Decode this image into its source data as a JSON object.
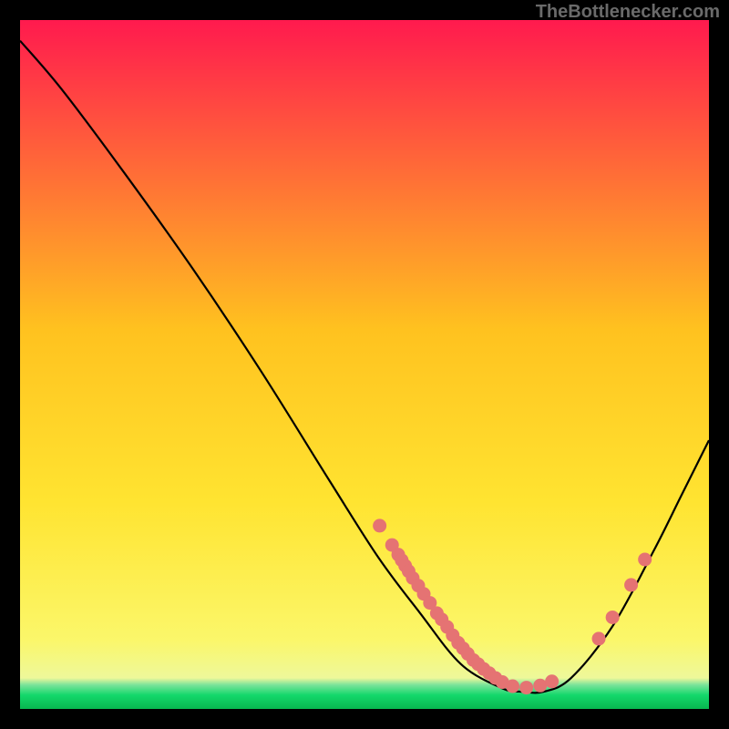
{
  "watermark": "TheBottlenecker.com",
  "chart_data": {
    "type": "line",
    "title": "",
    "xlabel": "",
    "ylabel": "",
    "xlim": [
      0,
      1
    ],
    "ylim": [
      0,
      1
    ],
    "background_gradient": {
      "top": "#ff1a4e",
      "mid1": "#ffd02a",
      "mid2": "#fff731",
      "green": "#13d86b",
      "bottom_band": "#08b64f"
    },
    "curve": [
      {
        "x": 0.0,
        "y": 0.03
      },
      {
        "x": 0.06,
        "y": 0.1
      },
      {
        "x": 0.15,
        "y": 0.22
      },
      {
        "x": 0.25,
        "y": 0.36
      },
      {
        "x": 0.35,
        "y": 0.51
      },
      {
        "x": 0.45,
        "y": 0.67
      },
      {
        "x": 0.52,
        "y": 0.78
      },
      {
        "x": 0.58,
        "y": 0.86
      },
      {
        "x": 0.64,
        "y": 0.935
      },
      {
        "x": 0.7,
        "y": 0.97
      },
      {
        "x": 0.73,
        "y": 0.975
      },
      {
        "x": 0.76,
        "y": 0.975
      },
      {
        "x": 0.8,
        "y": 0.955
      },
      {
        "x": 0.86,
        "y": 0.88
      },
      {
        "x": 0.92,
        "y": 0.77
      },
      {
        "x": 0.96,
        "y": 0.69
      },
      {
        "x": 1.0,
        "y": 0.61
      }
    ],
    "scatter_points": [
      {
        "x": 0.522,
        "y": 0.734
      },
      {
        "x": 0.54,
        "y": 0.762
      },
      {
        "x": 0.549,
        "y": 0.776
      },
      {
        "x": 0.554,
        "y": 0.784
      },
      {
        "x": 0.559,
        "y": 0.792
      },
      {
        "x": 0.564,
        "y": 0.8
      },
      {
        "x": 0.57,
        "y": 0.81
      },
      {
        "x": 0.578,
        "y": 0.821
      },
      {
        "x": 0.586,
        "y": 0.833
      },
      {
        "x": 0.595,
        "y": 0.846
      },
      {
        "x": 0.605,
        "y": 0.861
      },
      {
        "x": 0.612,
        "y": 0.87
      },
      {
        "x": 0.62,
        "y": 0.881
      },
      {
        "x": 0.628,
        "y": 0.893
      },
      {
        "x": 0.636,
        "y": 0.904
      },
      {
        "x": 0.643,
        "y": 0.912
      },
      {
        "x": 0.65,
        "y": 0.92
      },
      {
        "x": 0.658,
        "y": 0.929
      },
      {
        "x": 0.665,
        "y": 0.935
      },
      {
        "x": 0.673,
        "y": 0.942
      },
      {
        "x": 0.681,
        "y": 0.948
      },
      {
        "x": 0.69,
        "y": 0.955
      },
      {
        "x": 0.7,
        "y": 0.961
      },
      {
        "x": 0.715,
        "y": 0.967
      },
      {
        "x": 0.735,
        "y": 0.969
      },
      {
        "x": 0.755,
        "y": 0.966
      },
      {
        "x": 0.772,
        "y": 0.96
      },
      {
        "x": 0.84,
        "y": 0.898
      },
      {
        "x": 0.86,
        "y": 0.867
      },
      {
        "x": 0.887,
        "y": 0.82
      },
      {
        "x": 0.907,
        "y": 0.783
      }
    ],
    "scatter_color": "#e57373",
    "curve_color": "#000000"
  }
}
